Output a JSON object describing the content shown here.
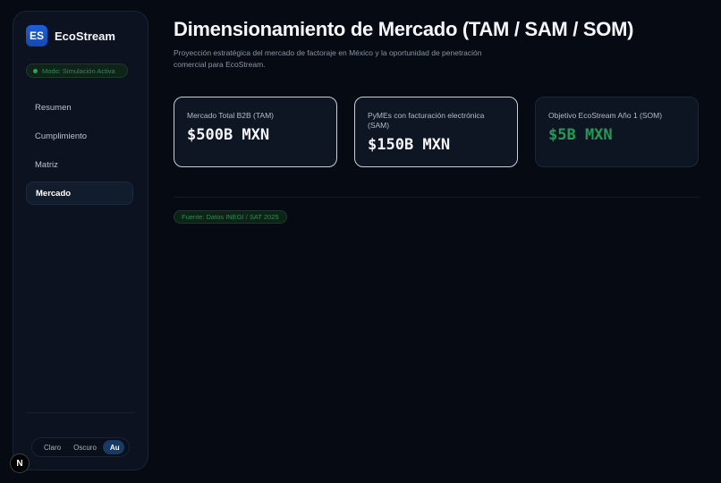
{
  "brand": {
    "logo_text": "ES",
    "name": "EcoStream"
  },
  "status": {
    "label": "Modo: Simulación Activa",
    "color": "#27a35b"
  },
  "nav": {
    "items": [
      {
        "label": "Resumen",
        "active": false
      },
      {
        "label": "Cumplimiento",
        "active": false
      },
      {
        "label": "Matriz",
        "active": false
      },
      {
        "label": "Mercado",
        "active": true
      }
    ]
  },
  "theme": {
    "options": [
      {
        "label": "Claro",
        "active": false
      },
      {
        "label": "Oscuro",
        "active": false
      },
      {
        "label": "Au",
        "active": true
      }
    ]
  },
  "badge": {
    "label": "N"
  },
  "main": {
    "title": "Dimensionamiento de Mercado (TAM / SAM / SOM)",
    "subtitle": "Proyección estratégica del mercado de factoraje en México y la oportunidad de penetración comercial para EcoStream.",
    "cards": [
      {
        "label": "Mercado Total B2B (TAM)",
        "value": "$500B MXN"
      },
      {
        "label": "PyMEs con facturación electrónica (SAM)",
        "value": "$150B MXN"
      },
      {
        "label": "Objetivo EcoStream Año 1 (SOM)",
        "value": "$5B MXN"
      }
    ],
    "source": "Fuente: Datos INEGI / SAT 2025"
  },
  "colors": {
    "accent": "#1e5fd6",
    "success": "#1f9d55",
    "background": "#060a13"
  }
}
